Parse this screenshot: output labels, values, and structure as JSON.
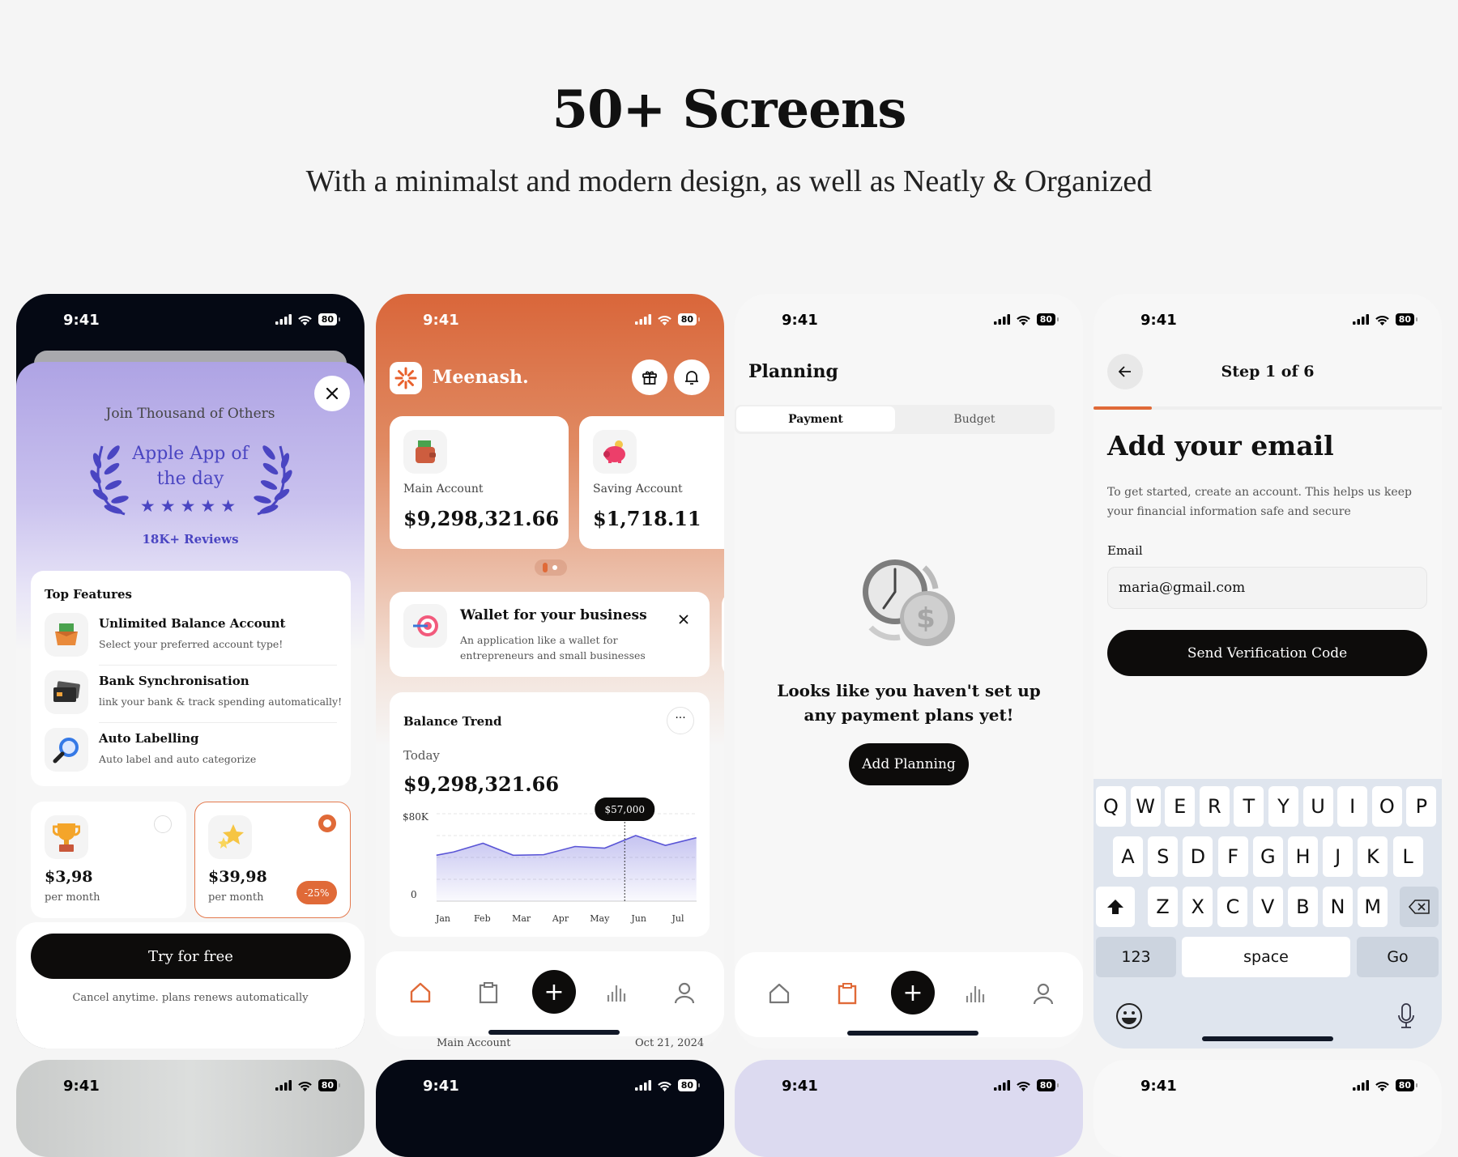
{
  "hero": {
    "title": "50+ Screens",
    "subtitle": "With a minimalst and modern design, as well as Neatly & Organized"
  },
  "status": {
    "time": "9:41",
    "battery": "80"
  },
  "paywall": {
    "join_text": "Join Thousand of Others",
    "award_line1": "Apple App of",
    "award_line2": "the day",
    "stars": 5,
    "reviews": "18K+ Reviews",
    "features_title": "Top Features",
    "features": [
      {
        "title": "Unlimited Balance Account",
        "subtitle": "Select your preferred account type!",
        "icon": "money-box-icon"
      },
      {
        "title": "Bank Synchronisation",
        "subtitle": "link your bank & track spending automatically!",
        "icon": "credit-cards-icon"
      },
      {
        "title": "Auto Labelling",
        "subtitle": "Auto label and auto categorize",
        "icon": "magnifier-icon"
      }
    ],
    "plans": [
      {
        "price": "$3,98",
        "period": "per month",
        "selected": false,
        "icon": "trophy-icon"
      },
      {
        "price": "$39,98",
        "period": "per month",
        "selected": true,
        "badge": "-25%",
        "icon": "stars-icon"
      }
    ],
    "cta": "Try for free",
    "footnote": "Cancel anytime. plans renews automatically"
  },
  "home": {
    "brand": "Meenash.",
    "accounts": [
      {
        "label": "Main Account",
        "amount": "$9,298,321.66",
        "icon": "wallet-icon"
      },
      {
        "label": "Saving Account",
        "amount": "$1,718.11",
        "icon": "piggy-bank-icon"
      }
    ],
    "pager": {
      "count": 2,
      "active": 0
    },
    "promo": {
      "title": "Wallet for your business",
      "text_line1": "An application like a wallet for",
      "text_line2": "entrepreneurs and small businesses"
    },
    "trend": {
      "title": "Balance Trend",
      "period": "Today",
      "amount": "$9,298,321.66",
      "tooltip": "$57,000"
    },
    "behind_row": {
      "label": "Main Account",
      "date": "Oct 21, 2024"
    }
  },
  "chart_data": {
    "type": "area",
    "title": "Balance Trend",
    "categories": [
      "Jan",
      "Feb",
      "Mar",
      "Apr",
      "May",
      "Jun",
      "Jul"
    ],
    "y_tick_labels": [
      "$80K",
      "0"
    ],
    "ylim": [
      0,
      80000
    ],
    "grid": true,
    "points": [
      [
        0.83,
        42000
      ],
      [
        1.27,
        45000
      ],
      [
        2.02,
        53000
      ],
      [
        2.79,
        42000
      ],
      [
        3.57,
        42500
      ],
      [
        4.37,
        50000
      ],
      [
        5.13,
        48500
      ],
      [
        5.92,
        60000
      ],
      [
        6.68,
        51000
      ],
      [
        7.47,
        58000
      ]
    ],
    "highlight": {
      "x": 5.64,
      "value": 57000,
      "label": "$57,000"
    },
    "color": "#5a55d6"
  },
  "planning": {
    "title": "Planning",
    "tabs": [
      {
        "label": "Payment",
        "active": true
      },
      {
        "label": "Budget",
        "active": false
      }
    ],
    "empty_line1": "Looks like you haven't set up",
    "empty_line2": "any payment plans yet!",
    "cta": "Add Planning"
  },
  "signup": {
    "step": "Step 1 of 6",
    "progress": 0.1667,
    "title": "Add your email",
    "desc_line1": "To get started, create an account. This helps us keep",
    "desc_line2": "your financial information safe and secure",
    "email_label": "Email",
    "email_value": "maria@gmail.com",
    "cta": "Send Verification Code",
    "keyboard": {
      "row1": [
        "Q",
        "W",
        "E",
        "R",
        "T",
        "Y",
        "U",
        "I",
        "O",
        "P"
      ],
      "row2": [
        "A",
        "S",
        "D",
        "F",
        "G",
        "H",
        "J",
        "K",
        "L"
      ],
      "row3": [
        "Z",
        "X",
        "C",
        "V",
        "B",
        "N",
        "M"
      ],
      "numbers": "123",
      "space": "space",
      "go": "Go"
    }
  },
  "colors": {
    "accent": "#e06a38",
    "award": "#4a45c2",
    "dark": "#0d0c0b",
    "keyboard": "#dfe5ee"
  }
}
